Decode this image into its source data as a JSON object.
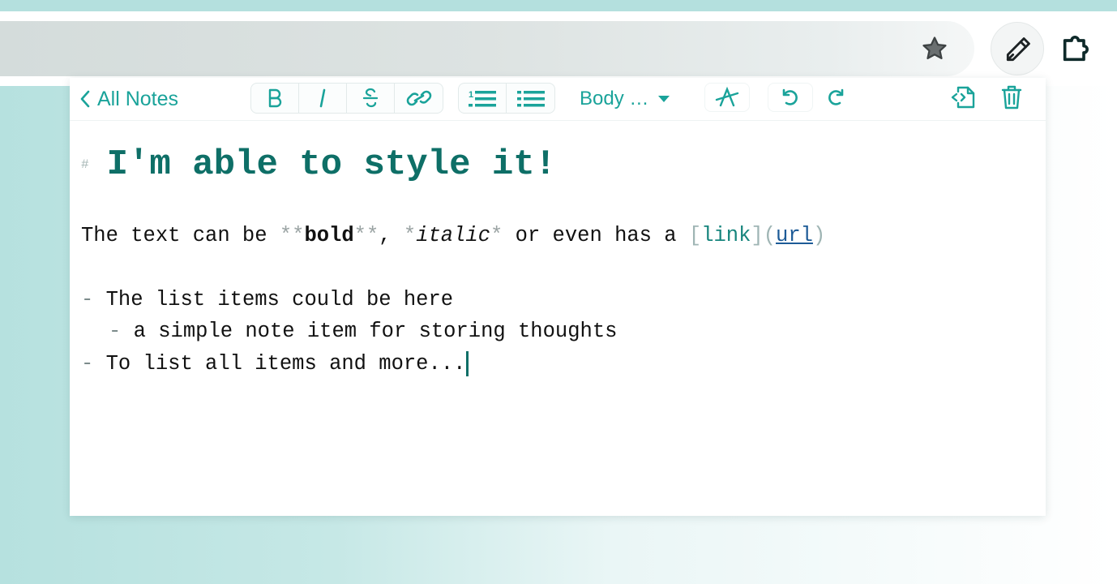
{
  "browser": {
    "star_icon": "star-icon",
    "pencil_icon": "pencil-icon",
    "extensions_icon": "puzzle-icon"
  },
  "toolbar": {
    "back_label": "All Notes",
    "format_buttons": [
      "bold",
      "italic",
      "strikethrough",
      "link"
    ],
    "list_buttons": [
      "ordered-list",
      "unordered-list"
    ],
    "style_select_value": "Body …",
    "clear_format_icon": "clear-format-icon",
    "undo_icon": "undo-icon",
    "redo_icon": "redo-icon",
    "export_icon": "export-code-icon",
    "delete_icon": "trash-icon"
  },
  "editor": {
    "heading_marker": "#",
    "heading_text": "I'm able to style it!",
    "paragraph": {
      "prefix": "The text can be ",
      "bold_open": "**",
      "bold_text": "bold",
      "bold_close": "**",
      "sep1": ", ",
      "italic_open": "*",
      "italic_text": "italic",
      "italic_close": "*",
      "middle": " or even has a ",
      "link_open": "[",
      "link_text": "link",
      "link_mid": "](",
      "link_url": "url",
      "link_close": ")"
    },
    "list": [
      {
        "marker": "-",
        "text": "The list items could be here",
        "indent": 0
      },
      {
        "marker": "-",
        "text": "a simple note item for storing thoughts",
        "indent": 1
      },
      {
        "marker": "-",
        "text": "To list all items and more...",
        "indent": 0
      }
    ]
  },
  "colors": {
    "accent": "#1aa39a",
    "heading": "#0e6f67",
    "link_url": "#1d5b97"
  }
}
